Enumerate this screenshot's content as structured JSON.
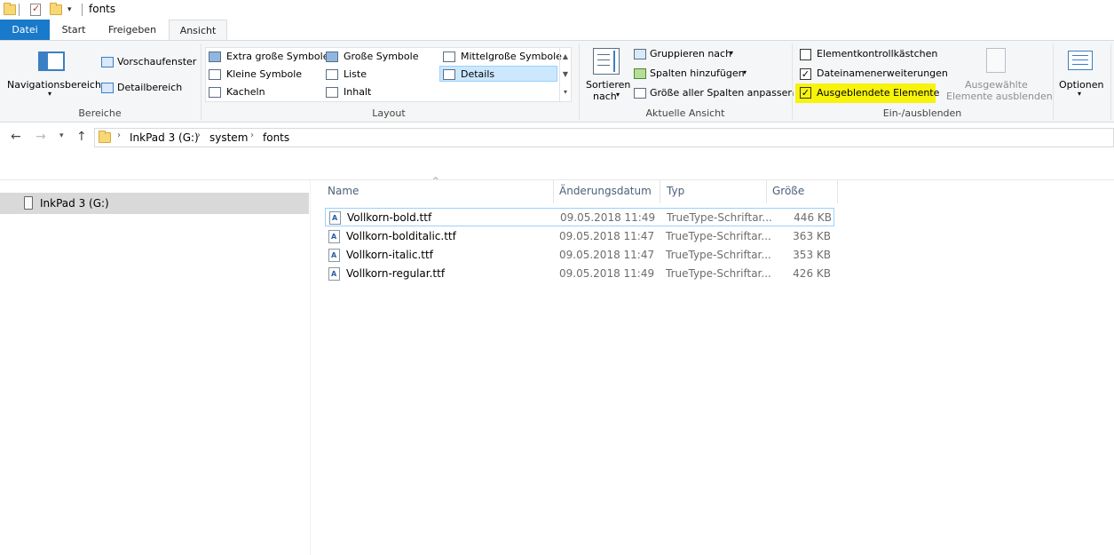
{
  "window": {
    "title": "fonts"
  },
  "tabs": {
    "datei": "Datei",
    "start": "Start",
    "freigeben": "Freigeben",
    "ansicht": "Ansicht"
  },
  "ribbon": {
    "bereiche": {
      "label": "Bereiche",
      "navigationsbereich": "Navigationsbereich",
      "vorschaufenster": "Vorschaufenster",
      "detailbereich": "Detailbereich"
    },
    "layout": {
      "label": "Layout",
      "items": {
        "extra_gross": "Extra große Symbole",
        "gross": "Große Symbole",
        "mittelgross": "Mittelgroße Symbole",
        "klein": "Kleine Symbole",
        "liste": "Liste",
        "details": "Details",
        "kacheln": "Kacheln",
        "inhalt": "Inhalt"
      },
      "selected": "Details"
    },
    "aktuelle_ansicht": {
      "label": "Aktuelle Ansicht",
      "sortieren_1": "Sortieren",
      "sortieren_2": "nach",
      "gruppieren": "Gruppieren nach",
      "spalten": "Spalten hinzufügen",
      "groesse": "Größe aller Spalten anpassen"
    },
    "ein_ausblenden": {
      "label": "Ein-/ausblenden",
      "elementkontroll": "Elementkontrollkästchen",
      "dateinamen": "Dateinamenerweiterungen",
      "ausgeblendete": "Ausgeblendete Elemente",
      "ausgewaehlte_1": "Ausgewählte",
      "ausgewaehlte_2": "Elemente ausblenden",
      "checkbox_elementkontroll": false,
      "checkbox_dateinamen": true,
      "checkbox_ausgeblendete": true
    },
    "optionen": {
      "label": "Optionen"
    }
  },
  "address": {
    "crumbs": [
      "InkPad 3 (G:)",
      "system",
      "fonts"
    ]
  },
  "navpane": {
    "selected_item": "InkPad 3 (G:)"
  },
  "filelist": {
    "columns": {
      "name": "Name",
      "date": "Änderungsdatum",
      "type": "Typ",
      "size": "Größe"
    },
    "rows": [
      {
        "name": "Vollkorn-bold.ttf",
        "date": "09.05.2018 11:49",
        "type": "TrueType-Schriftar...",
        "size": "446 KB"
      },
      {
        "name": "Vollkorn-bolditalic.ttf",
        "date": "09.05.2018 11:47",
        "type": "TrueType-Schriftar...",
        "size": "363 KB"
      },
      {
        "name": "Vollkorn-italic.ttf",
        "date": "09.05.2018 11:47",
        "type": "TrueType-Schriftar...",
        "size": "353 KB"
      },
      {
        "name": "Vollkorn-regular.ttf",
        "date": "09.05.2018 11:49",
        "type": "TrueType-Schriftar...",
        "size": "426 KB"
      }
    ]
  },
  "colors": {
    "accent": "#1979ca",
    "highlight": "#f7f30b",
    "selection": "#cce8ff"
  }
}
